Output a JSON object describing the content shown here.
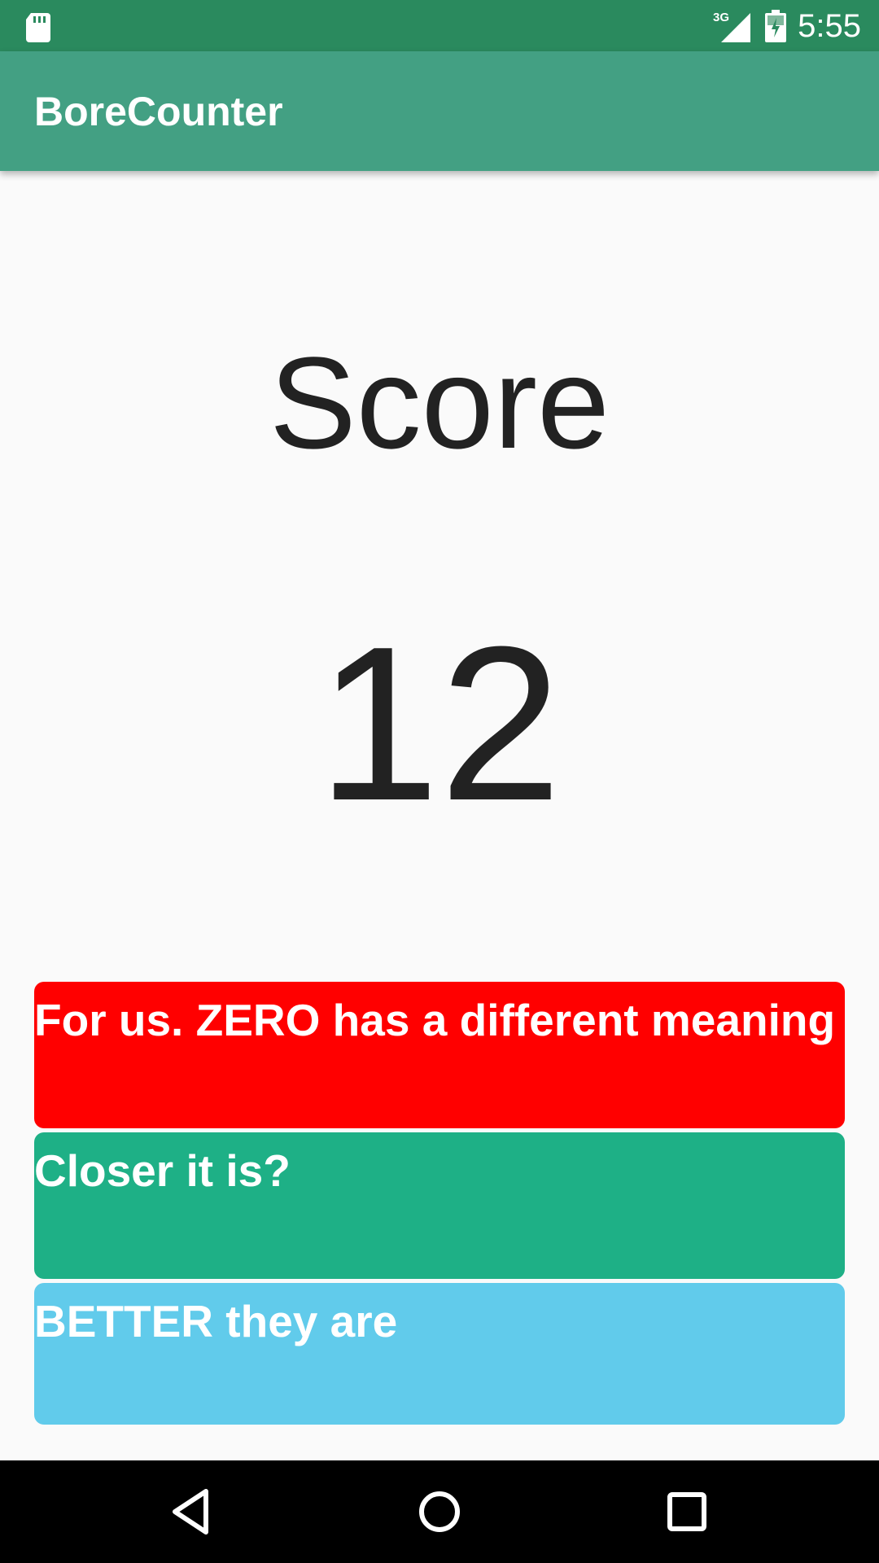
{
  "status_bar": {
    "time": "5:55",
    "network": "3G",
    "icons": [
      "sd-card-icon",
      "signal-icon",
      "battery-icon"
    ]
  },
  "app_bar": {
    "title": "BoreCounter",
    "color": "#43a083"
  },
  "main": {
    "score_label": "Score",
    "score_value": "12"
  },
  "answers": [
    {
      "label": "For us. ZERO has a different meaning",
      "color": "#ff0000"
    },
    {
      "label": "Closer it is?",
      "color": "#1eb086"
    },
    {
      "label": "BETTER they are",
      "color": "#61cbeb"
    }
  ],
  "nav_bar": {
    "icons": [
      "back-icon",
      "home-icon",
      "recents-icon"
    ]
  }
}
